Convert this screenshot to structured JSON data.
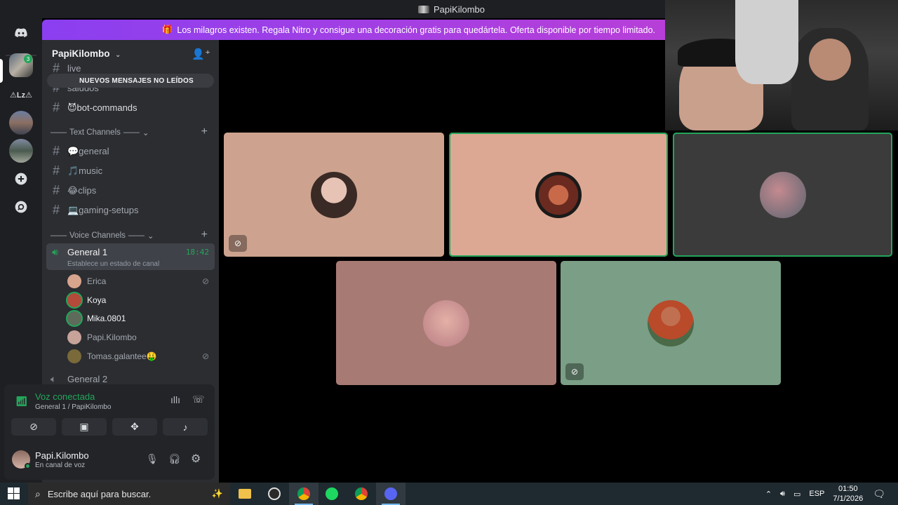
{
  "window": {
    "title": "PapiKilombo"
  },
  "banner": {
    "text": "Los milagros existen. Regala Nitro y consigue una decoración gratis para quedártela. Oferta disponible por tiempo limitado."
  },
  "rail": {
    "server_label": "⚠Lz⚠",
    "badge_count": "3"
  },
  "guild": {
    "name": "PapiKilombo"
  },
  "unread_pill": "NUEVOS MENSAJES NO LEÍDOS",
  "channels_top": [
    {
      "name": "live"
    },
    {
      "name": "saludos"
    },
    {
      "name": "😈bot-commands"
    }
  ],
  "text_category": "Text Channels",
  "text_channels": [
    {
      "name": "💬general"
    },
    {
      "name": "🎵music"
    },
    {
      "name": "😂clips"
    },
    {
      "name": "💻gaming-setups"
    }
  ],
  "voice_category": "Voice Channels",
  "voice_channel_active": {
    "name": "General 1",
    "duration": "18:42",
    "status_placeholder": "Establece un estado de canal"
  },
  "voice_users": [
    {
      "name": "Erica",
      "muted": true,
      "color": "#d7a48e"
    },
    {
      "name": "Koya",
      "muted": false,
      "color": "#b34a3a"
    },
    {
      "name": "Mika.0801",
      "muted": false,
      "color": "#5e6b5a"
    },
    {
      "name": "Papi.Kilombo",
      "muted": false,
      "color": "#c7a39a"
    },
    {
      "name": "Tomas.galantee🤑",
      "muted": true,
      "color": "#7a6a3a"
    }
  ],
  "voice_channel_2": {
    "name": "General 2"
  },
  "voice_panel": {
    "status": "Voz conectada",
    "location": "General 1 / PapiKilombo"
  },
  "user_panel": {
    "name": "Papi.Kilombo",
    "status": "En canal de voz"
  },
  "tiles": [
    {
      "name": "Erica",
      "bg": "#cda38f",
      "avatar": "#3a2a25",
      "muted": true,
      "active": false
    },
    {
      "name": "Koya",
      "bg": "#dda893",
      "avatar": "#6a2a20",
      "muted": false,
      "active": true
    },
    {
      "name": "Mika.0801",
      "bg": "#3b3b3b",
      "avatar": "#7c6a6a",
      "muted": false,
      "active": true
    },
    {
      "name": "Papi.Kilombo",
      "bg": "#a87a74",
      "avatar": "#d59b8e",
      "muted": false,
      "active": false
    },
    {
      "name": "Tomas.galantee",
      "bg": "#7a9e86",
      "avatar": "#5a3a24",
      "muted": true,
      "active": false
    }
  ],
  "taskbar": {
    "search_placeholder": "Escribe aquí para buscar.",
    "language": "ESP",
    "time": "01:50",
    "date": "7/1/2026"
  }
}
